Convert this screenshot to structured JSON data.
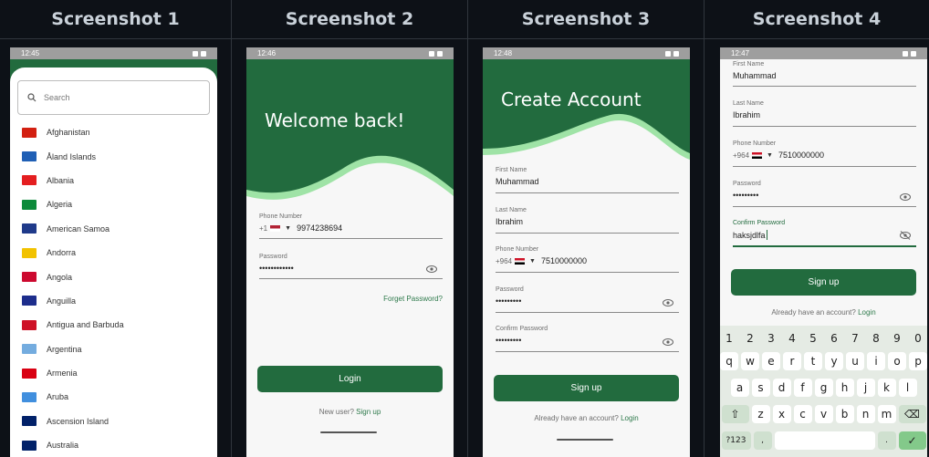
{
  "screenshots": [
    {
      "title": "Screenshot 1",
      "time": "12:45"
    },
    {
      "title": "Screenshot 2",
      "time": "12:46"
    },
    {
      "title": "Screenshot 3",
      "time": "12:48"
    },
    {
      "title": "Screenshot 4",
      "time": "12:47"
    }
  ],
  "s1": {
    "search_placeholder": "Search",
    "countries": [
      {
        "name": "Afghanistan",
        "color": "#d32011"
      },
      {
        "name": "Åland Islands",
        "color": "#1f5fb5"
      },
      {
        "name": "Albania",
        "color": "#e41e20"
      },
      {
        "name": "Algeria",
        "color": "#0c8a3a"
      },
      {
        "name": "American Samoa",
        "color": "#1f3a8a"
      },
      {
        "name": "Andorra",
        "color": "#f2c200"
      },
      {
        "name": "Angola",
        "color": "#cc092f"
      },
      {
        "name": "Anguilla",
        "color": "#1d2d8c"
      },
      {
        "name": "Antigua and Barbuda",
        "color": "#ce1126"
      },
      {
        "name": "Argentina",
        "color": "#74acdf"
      },
      {
        "name": "Armenia",
        "color": "#d90012"
      },
      {
        "name": "Aruba",
        "color": "#418fde"
      },
      {
        "name": "Ascension Island",
        "color": "#012169"
      },
      {
        "name": "Australia",
        "color": "#012169"
      }
    ]
  },
  "s2": {
    "title": "Welcome back!",
    "phone_label": "Phone Number",
    "phone_code": "+1",
    "phone_value": "9974238694",
    "password_label": "Password",
    "password_value": "••••••••••••",
    "forgot": "Forget Password?",
    "login_button": "Login",
    "new_user": "New user?",
    "signup_link": "Sign up"
  },
  "s3": {
    "title": "Create Account",
    "first_label": "First Name",
    "first_value": "Muhammad",
    "last_label": "Last Name",
    "last_value": "Ibrahim",
    "phone_label": "Phone Number",
    "phone_code": "+964",
    "phone_value": "7510000000",
    "password_label": "Password",
    "password_value": "•••••••••",
    "confirm_label": "Confirm Password",
    "confirm_value": "•••••••••",
    "signup_button": "Sign up",
    "have_account": "Already have an account?",
    "login_link": "Login"
  },
  "s4": {
    "first_label": "First Name",
    "first_value": "Muhammad",
    "last_label": "Last Name",
    "last_value": "Ibrahim",
    "phone_label": "Phone Number",
    "phone_code": "+964",
    "phone_value": "7510000000",
    "password_label": "Password",
    "password_value": "•••••••••",
    "confirm_label": "Confirm Password",
    "confirm_value": "haksjdlfa",
    "signup_button": "Sign up",
    "have_account": "Already have an account?",
    "login_link": "Login",
    "keyboard": {
      "numbers": [
        "1",
        "2",
        "3",
        "4",
        "5",
        "6",
        "7",
        "8",
        "9",
        "0"
      ],
      "row1": [
        "q",
        "w",
        "e",
        "r",
        "t",
        "y",
        "u",
        "i",
        "o",
        "p"
      ],
      "row2": [
        "a",
        "s",
        "d",
        "f",
        "g",
        "h",
        "j",
        "k",
        "l"
      ],
      "row3": [
        "z",
        "x",
        "c",
        "v",
        "b",
        "n",
        "m"
      ],
      "symbols_key": "?123",
      "comma_key": ",",
      "period_key": "."
    }
  },
  "colors": {
    "brand_green": "#226b3e",
    "wave_light": "#9fe3a6"
  }
}
